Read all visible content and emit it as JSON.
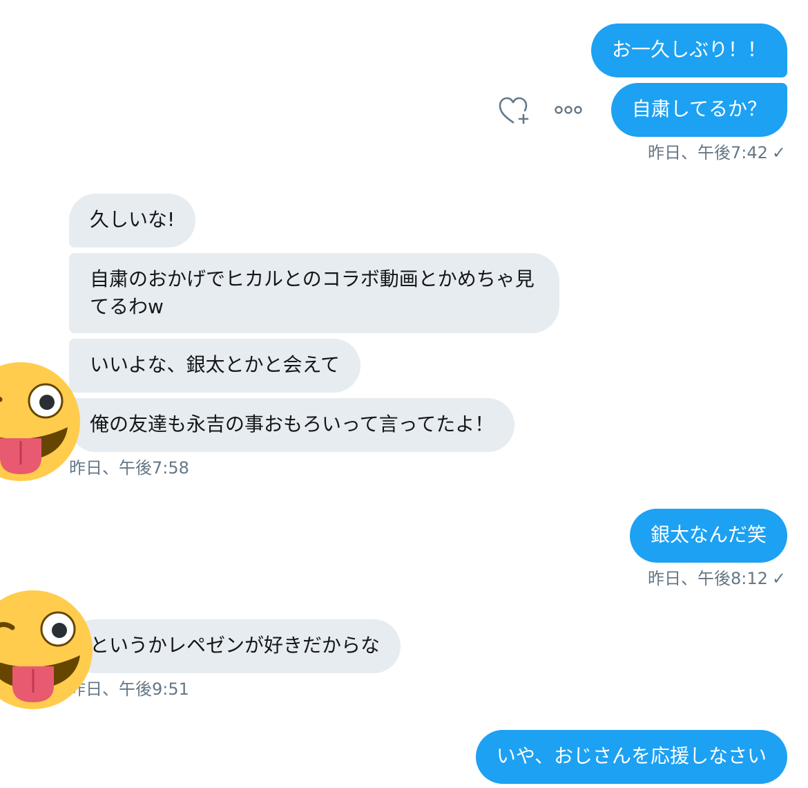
{
  "thread": {
    "messages": [
      {
        "side": "sent",
        "text": "お一久しぶり！！"
      },
      {
        "side": "sent",
        "text": "自粛してるか？"
      },
      {
        "side": "recv",
        "text": "久しいな!"
      },
      {
        "side": "recv",
        "text": "自粛のおかげでヒカルとのコラボ動画とかめちゃ見てるわw"
      },
      {
        "side": "recv",
        "text": "いいよな、銀太とかと会えて"
      },
      {
        "side": "recv",
        "text": "俺の友達も永吉の事おもろいって言ってたよ！"
      },
      {
        "side": "sent",
        "text": "銀太なんだ笑"
      },
      {
        "side": "recv",
        "text": "というかレペゼンが好きだからな"
      },
      {
        "side": "sent",
        "text": "いや、おじさんを応援しなさい"
      }
    ],
    "timestamps": {
      "t1": "昨日、午後7:42",
      "t2": "昨日、午後7:58",
      "t3": "昨日、午後8:12",
      "t4": "昨日、午後9:51"
    },
    "read_mark": "✓"
  },
  "icons": {
    "like": "heart-plus-icon",
    "more": "more-dots-icon",
    "avatar": "winking-tongue-emoji-avatar"
  },
  "colors": {
    "sent_bubble": "#1da1f2",
    "recv_bubble": "#e6ecf0",
    "timestamp": "#657786",
    "emoji_face": "#ffcc4d",
    "emoji_tongue": "#e75a70"
  }
}
